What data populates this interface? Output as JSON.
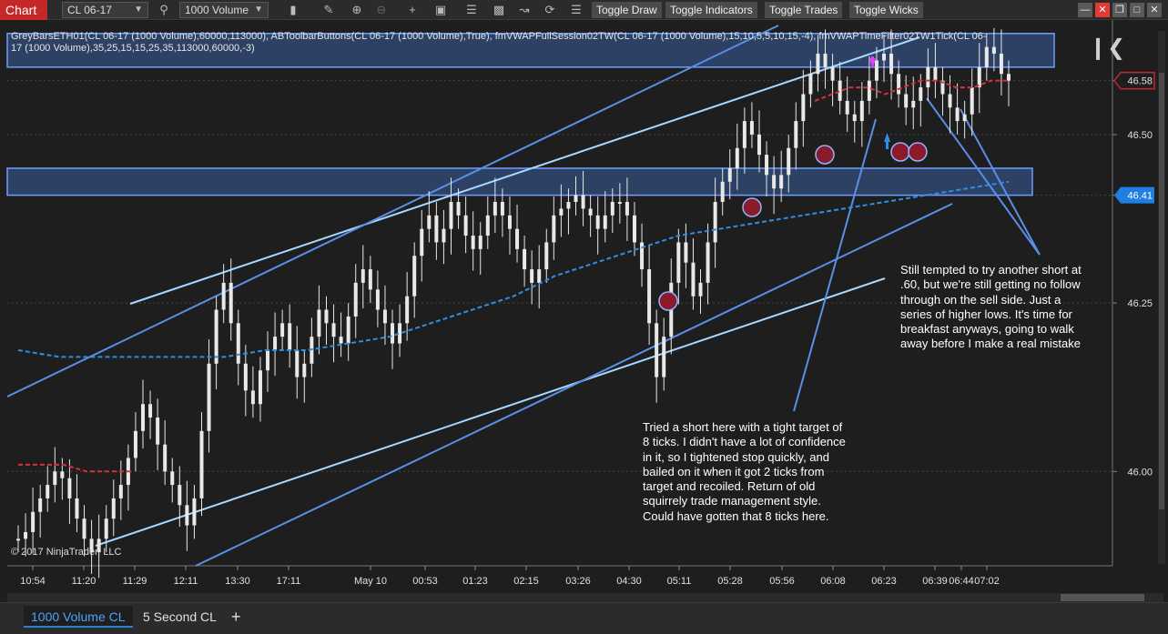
{
  "toolbar": {
    "chart_tab": "Chart",
    "instrument": "CL 06-17",
    "bar_type": "1000 Volume",
    "buttons": [
      "Toggle Draw",
      "Toggle Indicators",
      "Toggle Trades",
      "Toggle Wicks"
    ]
  },
  "indicator_label": "GreyBarsETH01(CL 06-17 (1000 Volume),60000,113000), ABToolbarButtons(CL 06-17 (1000 Volume),True), fmVWAPFullSession02TW(CL 06-17 (1000 Volume),15,10,5,5,10,15,-4), fmVWAPTimeFilter02TW1Tick(CL 06-17 (1000 Volume),35,25,15,15,25,35,113000,60000,-3)",
  "copyright": "© 2017 NinjaTrader, LLC",
  "annotation_short": "Tried a short here with a tight target of 8 ticks. I didn't have a lot of confidence in it, so I tightened stop quickly, and bailed on it when it got 2 ticks from target and recoiled. Return of old squirrely trade management style. Could have gotten that 8 ticks here.",
  "annotation_tempted": "Still tempted to try another short at .60, but we're still getting no follow through on the sell side. Just a series of higher lows. It's time for breakfast anyways, going to walk away before I make a real mistake",
  "bottom_tabs": [
    "1000 Volume CL",
    "5 Second CL"
  ],
  "add_tab": "+",
  "colors": {
    "background": "#1e1e1e",
    "bars": "#e8e8e8",
    "zone_fill": "#3a5fa0",
    "zone_border": "#6f9eff",
    "trendline_light": "#a8d8ff",
    "trendline_blue": "#5a8fe8",
    "vwap": "#2f8ee6",
    "vwap_short": "#d63040",
    "marker_fill": "#8b1a2a",
    "price_flag_last": "#c62828",
    "price_flag_blue": "#1f7fe0"
  },
  "chart_data": {
    "type": "bar",
    "instrument": "CL 06-17",
    "bar_type": "1000 Volume",
    "y_ticks": [
      "46.58",
      "46.50",
      "46.41",
      "46.25",
      "46.00"
    ],
    "x_ticks": [
      "10:54",
      "11:20",
      "11:29",
      "12:11",
      "13:30",
      "17:11",
      "May 10",
      "00:53",
      "01:23",
      "02:15",
      "03:26",
      "04:30",
      "05:11",
      "05:28",
      "05:56",
      "06:08",
      "06:23",
      "06:39",
      "06:44",
      "07:02"
    ],
    "last_price": "46.58",
    "marked_price": "46.41",
    "ylim": [
      45.86,
      46.67
    ],
    "candles_approx": [
      45.9,
      45.91,
      45.94,
      45.96,
      45.98,
      46.0,
      45.99,
      45.96,
      45.93,
      45.9,
      45.88,
      45.9,
      45.93,
      45.96,
      45.98,
      46.02,
      46.06,
      46.1,
      46.08,
      46.04,
      46.0,
      45.98,
      45.95,
      45.92,
      45.96,
      46.06,
      46.16,
      46.24,
      46.28,
      46.22,
      46.16,
      46.12,
      46.1,
      46.15,
      46.18,
      46.2,
      46.22,
      46.18,
      46.14,
      46.16,
      46.2,
      46.24,
      46.22,
      46.2,
      46.19,
      46.23,
      46.28,
      46.3,
      46.27,
      46.24,
      46.22,
      46.19,
      46.22,
      46.26,
      46.32,
      46.36,
      46.38,
      46.34,
      46.36,
      46.4,
      46.38,
      46.35,
      46.33,
      46.35,
      46.38,
      46.4,
      46.38,
      46.36,
      46.33,
      46.3,
      46.28,
      46.3,
      46.34,
      46.38,
      46.39,
      46.4,
      46.41,
      46.39,
      46.38,
      46.36,
      46.38,
      46.4,
      46.4,
      46.38,
      46.34,
      46.3,
      46.22,
      46.14,
      46.2,
      46.28,
      46.34,
      46.31,
      46.26,
      46.28,
      46.34,
      46.4,
      46.43,
      46.45,
      46.48,
      46.52,
      46.5,
      46.47,
      46.44,
      46.42,
      46.44,
      46.48,
      46.52,
      46.56,
      46.59,
      46.62,
      46.6,
      46.58,
      46.55,
      46.53,
      46.52,
      46.55,
      46.58,
      46.61,
      46.62,
      46.59,
      46.56,
      46.54,
      46.55,
      46.57,
      46.6,
      46.58,
      46.56,
      46.54,
      46.52,
      46.53,
      46.57,
      46.6,
      46.63,
      46.62,
      46.59,
      46.58
    ],
    "vwap_values_approx": [
      46.18,
      46.17,
      46.17,
      46.17,
      46.17,
      46.17,
      46.18,
      46.18,
      46.19,
      46.2,
      46.22,
      46.24,
      46.26,
      46.29,
      46.31,
      46.33,
      46.35,
      46.36,
      46.37,
      46.38,
      46.39,
      46.4,
      46.41,
      46.42,
      46.43
    ],
    "vwap_short_values_approx": [
      46.01,
      46.01,
      46.01,
      46.0,
      46.0,
      46.0
    ],
    "vwap_recent_values_approx": [
      46.55,
      46.56,
      46.57,
      46.57,
      46.56,
      46.57,
      46.58,
      46.58,
      46.57,
      46.57,
      46.58,
      46.58
    ],
    "zones": [
      {
        "from": 46.6,
        "to": 46.65
      },
      {
        "from": 46.41,
        "to": 46.45
      }
    ]
  }
}
